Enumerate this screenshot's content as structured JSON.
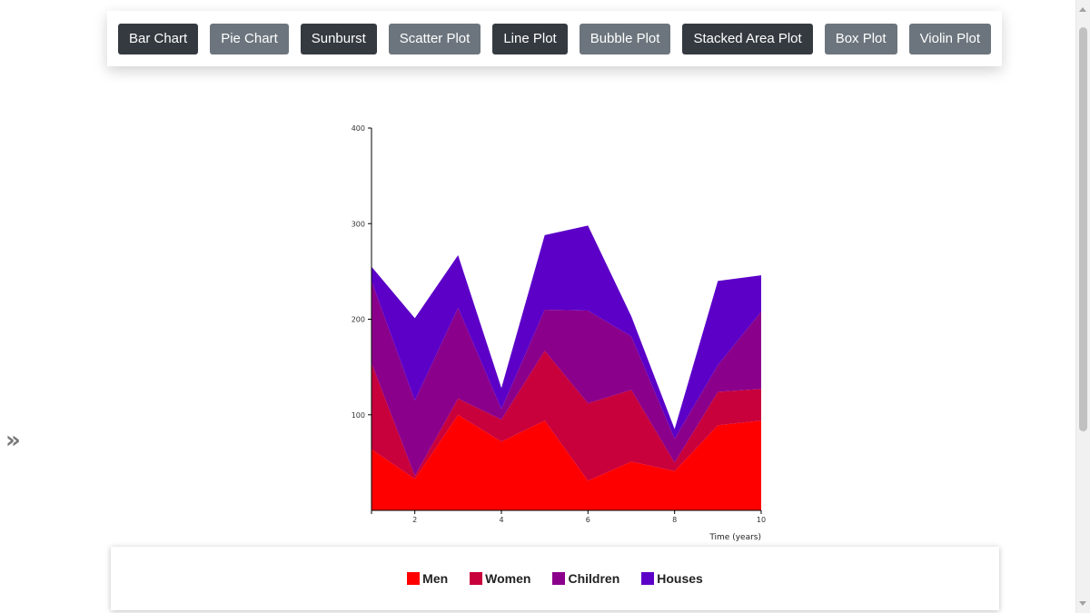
{
  "toolbar": {
    "buttons": [
      {
        "label": "Bar Chart",
        "style": "dark"
      },
      {
        "label": "Pie Chart",
        "style": "gray"
      },
      {
        "label": "Sunburst",
        "style": "dark"
      },
      {
        "label": "Scatter Plot",
        "style": "gray"
      },
      {
        "label": "Line Plot",
        "style": "dark"
      },
      {
        "label": "Bubble Plot",
        "style": "gray"
      },
      {
        "label": "Stacked Area Plot",
        "style": "dark"
      },
      {
        "label": "Box Plot",
        "style": "gray"
      },
      {
        "label": "Violin Plot",
        "style": "gray"
      }
    ]
  },
  "sidebar_toggle": {
    "icon": "double-chevron-right-icon",
    "glyph": "»"
  },
  "chart_data": {
    "type": "area",
    "stacked": true,
    "title": "",
    "xlabel": "Time (years)",
    "ylabel": "",
    "x": [
      1,
      2,
      3,
      4,
      5,
      6,
      7,
      8,
      9,
      10
    ],
    "xlim": [
      1,
      10
    ],
    "ylim": [
      0,
      400
    ],
    "xticks": [
      2,
      4,
      6,
      8,
      10
    ],
    "yticks": [
      100,
      200,
      300,
      400
    ],
    "series": [
      {
        "name": "Men",
        "color": "#ff0000",
        "values": [
          64,
          33,
          100,
          72,
          94,
          31,
          51,
          41,
          89,
          94
        ]
      },
      {
        "name": "Women",
        "color": "#c8003c",
        "values": [
          90,
          3,
          17,
          23,
          73,
          81,
          75,
          9,
          35,
          33
        ]
      },
      {
        "name": "Children",
        "color": "#8b008b",
        "values": [
          86,
          79,
          95,
          11,
          43,
          97,
          56,
          25,
          28,
          81
        ]
      },
      {
        "name": "Houses",
        "color": "#5c00c8",
        "values": [
          15,
          86,
          55,
          22,
          78,
          89,
          21,
          10,
          88,
          38
        ]
      }
    ],
    "grid": false,
    "legend_position": "bottom"
  }
}
